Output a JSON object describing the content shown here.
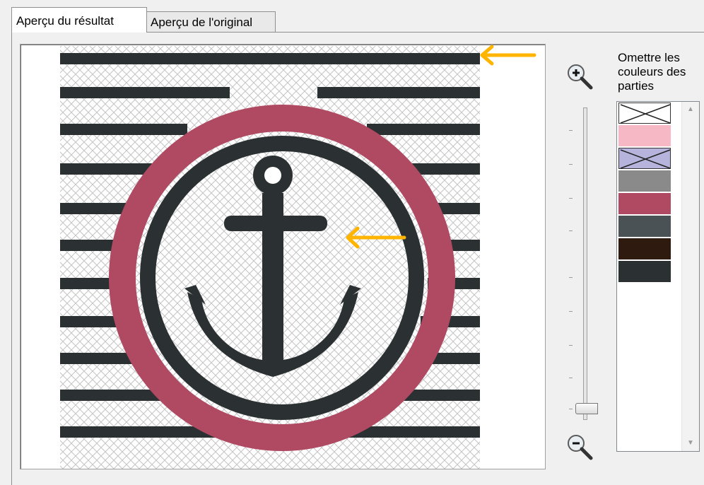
{
  "tabs": [
    {
      "label": "Aperçu du résultat",
      "active": true
    },
    {
      "label": "Aperçu de l'original",
      "active": false
    }
  ],
  "omit_colors": {
    "label": "Omettre les couleurs des parties",
    "swatches": [
      {
        "name": "transparent-white",
        "color": "#ffffff",
        "omitted": true
      },
      {
        "name": "light-pink",
        "color": "#f7b8c6",
        "omitted": false
      },
      {
        "name": "lavender",
        "color": "#b6b4dc",
        "omitted": true
      },
      {
        "name": "gray",
        "color": "#8a8a8a",
        "omitted": false
      },
      {
        "name": "raspberry",
        "color": "#b04a62",
        "omitted": false
      },
      {
        "name": "slate",
        "color": "#4a5256",
        "omitted": false
      },
      {
        "name": "dark-brown",
        "color": "#2e1a0e",
        "omitted": false
      },
      {
        "name": "charcoal",
        "color": "#2b3133",
        "omitted": false
      }
    ]
  },
  "zoom": {
    "in_icon": "zoom-in-icon",
    "out_icon": "zoom-out-icon",
    "level": 0.05
  },
  "colors": {
    "accent_arrow": "#ffb400",
    "stripe": "#2b3133",
    "ring": "#b04a62"
  }
}
